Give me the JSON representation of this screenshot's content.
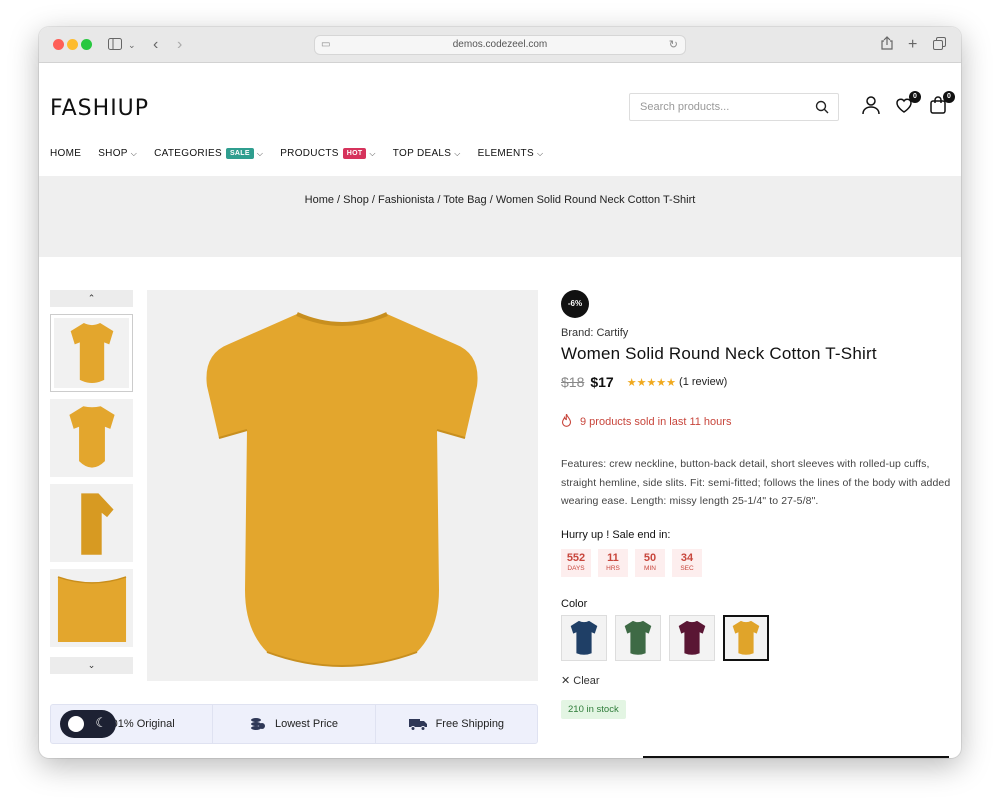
{
  "browser": {
    "url": "demos.codezeel.com",
    "colors": {
      "close": "#fe5f57",
      "minimize": "#febc2e",
      "maximize": "#28c840"
    }
  },
  "site": {
    "logo": "FASHIUP",
    "search_placeholder": "Search products...",
    "wishlist_count": "0",
    "cart_count": "0",
    "nav": [
      {
        "label": "HOME",
        "dropdown": false
      },
      {
        "label": "SHOP",
        "dropdown": true
      },
      {
        "label": "CATEGORIES",
        "tag": "SALE",
        "tag_color": "#2f9e8f",
        "dropdown": true
      },
      {
        "label": "PRODUCTS",
        "tag": "HOT",
        "tag_color": "#d6335c",
        "dropdown": true
      },
      {
        "label": "TOP DEALS",
        "dropdown": true
      },
      {
        "label": "ELEMENTS",
        "dropdown": true
      }
    ]
  },
  "breadcrumb": "Home / Shop / Fashionista / Tote Bag / Women Solid Round Neck Cotton T-Shirt",
  "product": {
    "discount": "-6%",
    "brand_label": "Brand:",
    "brand": "Cartify",
    "title": "Women Solid Round Neck Cotton T-Shirt",
    "old_price": "$18",
    "price": "$17",
    "rating": 5,
    "stars": "★★★★★",
    "reviews": "(1 review)",
    "sold_notice": "9 products sold in last 11 hours",
    "description": "Features: crew neckline, button-back detail, short sleeves with rolled-up cuffs, straight hemline, side slits. Fit: semi-fitted; follows the lines of the body with added wearing ease. Length: missy length 25-1/4\" to 27-5/8\".",
    "hurry_text": "Hurry up ! Sale end in:",
    "countdown": [
      {
        "value": "552",
        "unit": "DAYS"
      },
      {
        "value": "11",
        "unit": "HRS"
      },
      {
        "value": "50",
        "unit": "MIN"
      },
      {
        "value": "34",
        "unit": "SEC"
      }
    ],
    "color_label": "Color",
    "colors": [
      {
        "name": "navy",
        "hex": "#1f3f66"
      },
      {
        "name": "green",
        "hex": "#3e6a45"
      },
      {
        "name": "maroon",
        "hex": "#5a1634"
      },
      {
        "name": "mustard",
        "hex": "#e0a42a"
      }
    ],
    "selected_color": "mustard",
    "clear_label": "✕ Clear",
    "stock": "210 in stock",
    "main_color": "#e3a62d"
  },
  "features": [
    {
      "icon": "badge-icon",
      "label": "01% Original"
    },
    {
      "icon": "coins-icon",
      "label": "Lowest Price"
    },
    {
      "icon": "truck-icon",
      "label": "Free Shipping"
    }
  ]
}
